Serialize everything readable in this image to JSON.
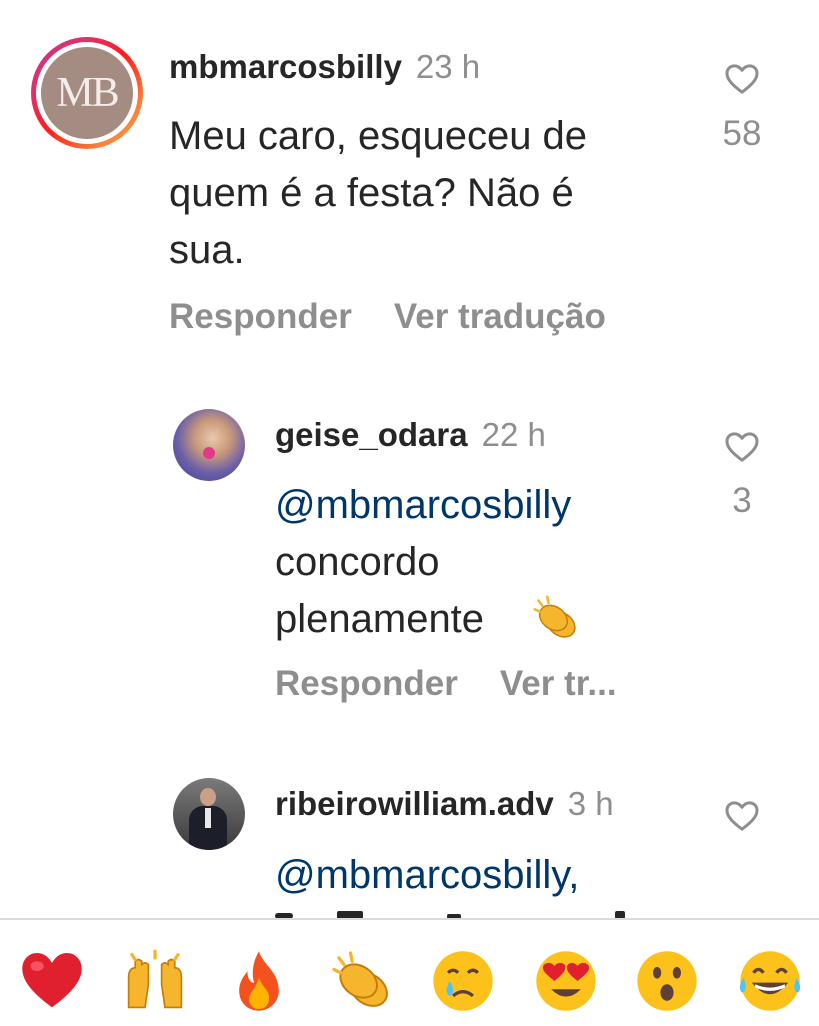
{
  "comments": [
    {
      "avatar_initials": "MB",
      "username": "mbmarcosbilly",
      "time": "23 h",
      "text_lines": [
        "Meu caro, esqueceu de",
        "quem é a festa? Não é",
        "sua."
      ],
      "likes": "58",
      "actions": [
        "Responder",
        "Ver tradução"
      ]
    },
    {
      "username": "geise_odara",
      "time": "22 h",
      "mention": "@mbmarcosbilly",
      "text_lines": [
        "concordo",
        "plenamente"
      ],
      "likes": "3",
      "actions": [
        "Responder",
        "Ver tr..."
      ]
    },
    {
      "username": "ribeirowilliam.adv",
      "time": "3 h",
      "mention": "@mbmarcosbilly,"
    }
  ],
  "reactions": [
    "red-heart",
    "raising-hands",
    "fire",
    "clapping-hands",
    "crying-face",
    "heart-eyes-face",
    "surprised-face",
    "tears-of-joy-face"
  ],
  "colors": {
    "mention": "#00376b",
    "secondary": "#8e8e8e",
    "text": "#262626"
  }
}
